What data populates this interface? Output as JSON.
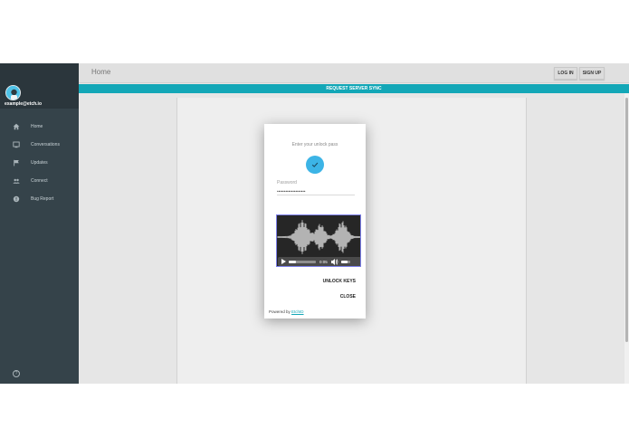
{
  "sidebar": {
    "user_email": "example@etch.io",
    "items": [
      {
        "label": "Home",
        "icon": "home-icon"
      },
      {
        "label": "Conversations",
        "icon": "inbox-icon"
      },
      {
        "label": "Updates",
        "icon": "flag-icon"
      },
      {
        "label": "Connect",
        "icon": "people-icon"
      },
      {
        "label": "Bug Report",
        "icon": "bug-icon"
      }
    ],
    "help_glyph": "?"
  },
  "header": {
    "title": "Home",
    "login_label": "LOG IN",
    "signup_label": "SIGN UP"
  },
  "sync_bar": {
    "label": "REQUEST SERVER SYNC"
  },
  "dialog": {
    "prompt": "Enter your unlock pass",
    "password_label": "Password",
    "password_value": "••••••••••••••••••••",
    "audio": {
      "time": "0:05",
      "progress": 0.25,
      "volume": 0.7
    },
    "unlock_label": "UNLOCK KEYS",
    "close_label": "CLOSE",
    "powered_prefix": "Powered by",
    "powered_brand": "EtchID"
  },
  "colors": {
    "sidebar_bg": "#35434a",
    "accent_teal": "#13a7b7",
    "check_blue": "#3cb4e6",
    "audio_border": "#7b7ee8"
  }
}
